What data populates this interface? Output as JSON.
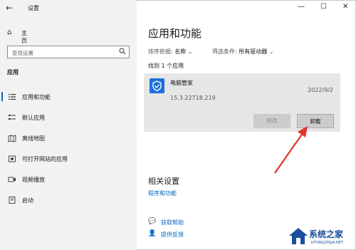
{
  "window": {
    "title": "设置",
    "back_icon": "←",
    "minimize": "—",
    "maximize": "☐",
    "close": "✕"
  },
  "sidebar": {
    "home_label": "主页",
    "search_placeholder": "查找设置",
    "section_title": "应用",
    "items": [
      {
        "label": "应用和功能",
        "icon": "list-icon",
        "selected": true
      },
      {
        "label": "默认应用",
        "icon": "default-apps-icon",
        "selected": false
      },
      {
        "label": "离线地图",
        "icon": "map-icon",
        "selected": false
      },
      {
        "label": "可打开网站的应用",
        "icon": "web-app-icon",
        "selected": false
      },
      {
        "label": "视频播放",
        "icon": "video-icon",
        "selected": false
      },
      {
        "label": "启动",
        "icon": "startup-icon",
        "selected": false
      }
    ]
  },
  "main": {
    "title": "应用和功能",
    "sort_label": "排序依据:",
    "sort_value": "名称",
    "filter_label": "筛选条件:",
    "filter_value": "所有驱动器",
    "found_text": "找到 1 个应用",
    "app": {
      "name": "电脑管家",
      "version": "15.3.22718.219",
      "date": "2022/9/2",
      "icon_color": "#1e6fdc"
    },
    "modify_label": "修改",
    "uninstall_label": "卸载",
    "related_title": "相关设置",
    "related_link": "程序和功能",
    "help_label": "获取帮助",
    "feedback_label": "提供反馈"
  },
  "watermark": {
    "title": "系统之家",
    "subtitle": "XITONGZHIJIA.NET"
  },
  "colors": {
    "accent": "#0067c0",
    "sidebar_bg": "#f2f2f2",
    "card_bg": "#e6e6e6",
    "arrow": "#e0322b"
  }
}
